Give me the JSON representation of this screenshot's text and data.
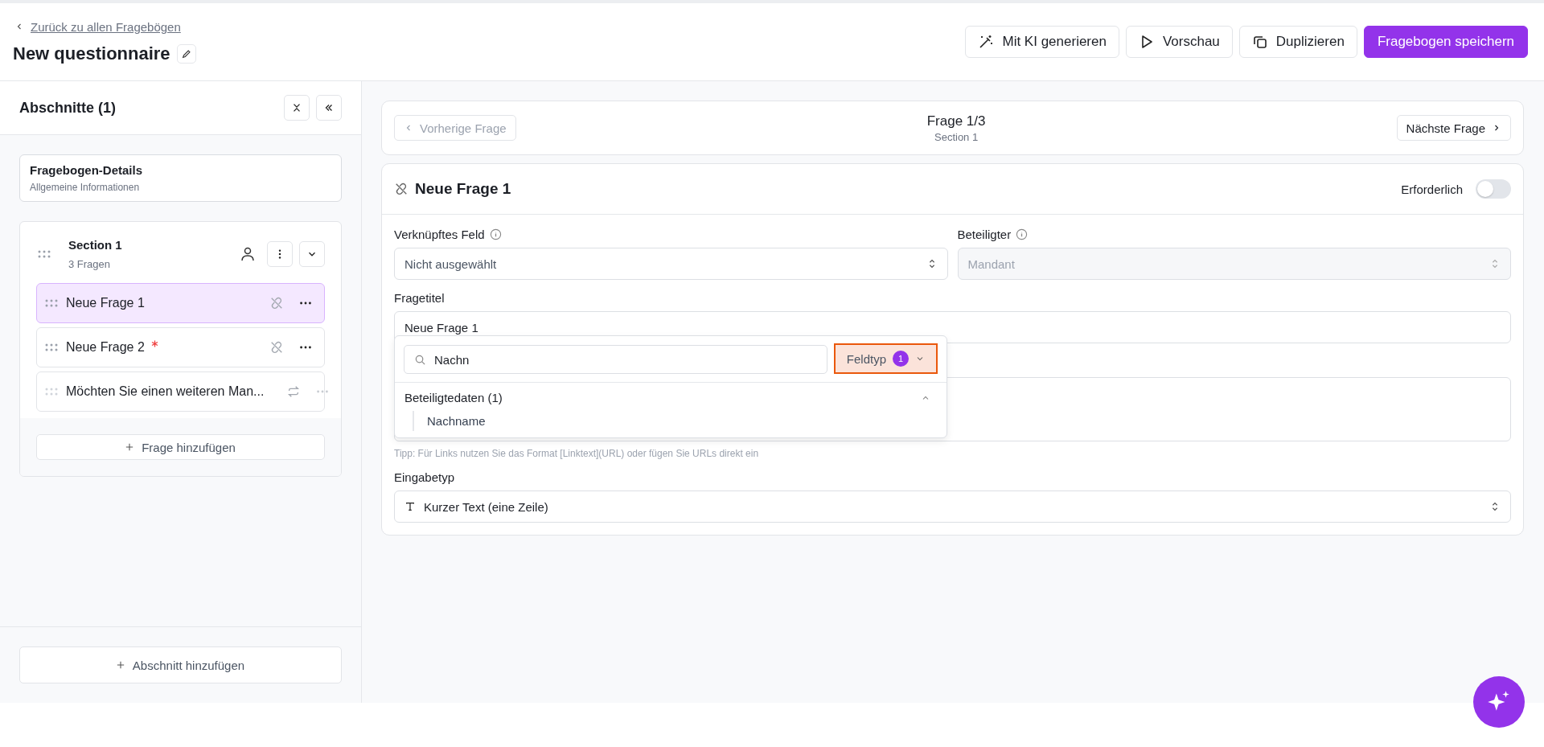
{
  "header": {
    "back_link": "Zurück zu allen Fragebögen",
    "title": "New questionnaire",
    "actions": [
      {
        "label": "Mit KI generieren",
        "kind": "ai"
      },
      {
        "label": "Vorschau",
        "kind": "preview"
      },
      {
        "label": "Duplizieren",
        "kind": "duplicate"
      },
      {
        "label": "Fragebogen speichern",
        "kind": "primary"
      }
    ]
  },
  "sidebar": {
    "title": "Abschnitte (1)",
    "details": {
      "title": "Fragebogen-Details",
      "subtitle": "Allgemeine Informationen"
    },
    "sections": [
      {
        "title": "Section 1",
        "count": "3 Fragen",
        "expanded": true,
        "questions": [
          {
            "title": "Neue Frage 1",
            "selected": true,
            "required": false,
            "kind": "unlinked"
          },
          {
            "title": "Neue Frage 2",
            "selected": false,
            "required": true,
            "kind": "unlinked"
          },
          {
            "title": "Möchten Sie einen weiteren Man...",
            "selected": false,
            "required": false,
            "kind": "repeat"
          }
        ]
      }
    ],
    "add_question": "Frage hinzufügen",
    "add_section": "Abschnitt hinzufügen"
  },
  "nav": {
    "prev": {
      "label": "Vorherige Frage",
      "disabled": true
    },
    "position": "Frage 1/3",
    "section": "Section 1",
    "next": {
      "label": "Nächste Frage",
      "disabled": false
    }
  },
  "question": {
    "title": "Neue Frage 1",
    "required_label": "Erforderlich",
    "required": false,
    "linked_field": {
      "label": "Verknüpftes Feld",
      "value": "Nicht ausgewählt"
    },
    "participant": {
      "label": "Beteiligter",
      "value": "Mandant",
      "disabled": true
    },
    "title_field": {
      "label": "Fragetitel",
      "value": "Neue Frage 1"
    },
    "hint": "Tipp: Für Links nutzen Sie das Format [Linktext](URL) oder fügen Sie URLs direkt ein",
    "input_type": {
      "label": "Eingabetyp",
      "value": "Kurzer Text (eine Zeile)"
    }
  },
  "field_picker": {
    "search": "Nachn",
    "filter": {
      "label": "Feldtyp",
      "count": "1"
    },
    "groups": [
      {
        "title": "Beteiligtedaten (1)",
        "expanded": true,
        "items": [
          "Nachname"
        ]
      }
    ]
  }
}
